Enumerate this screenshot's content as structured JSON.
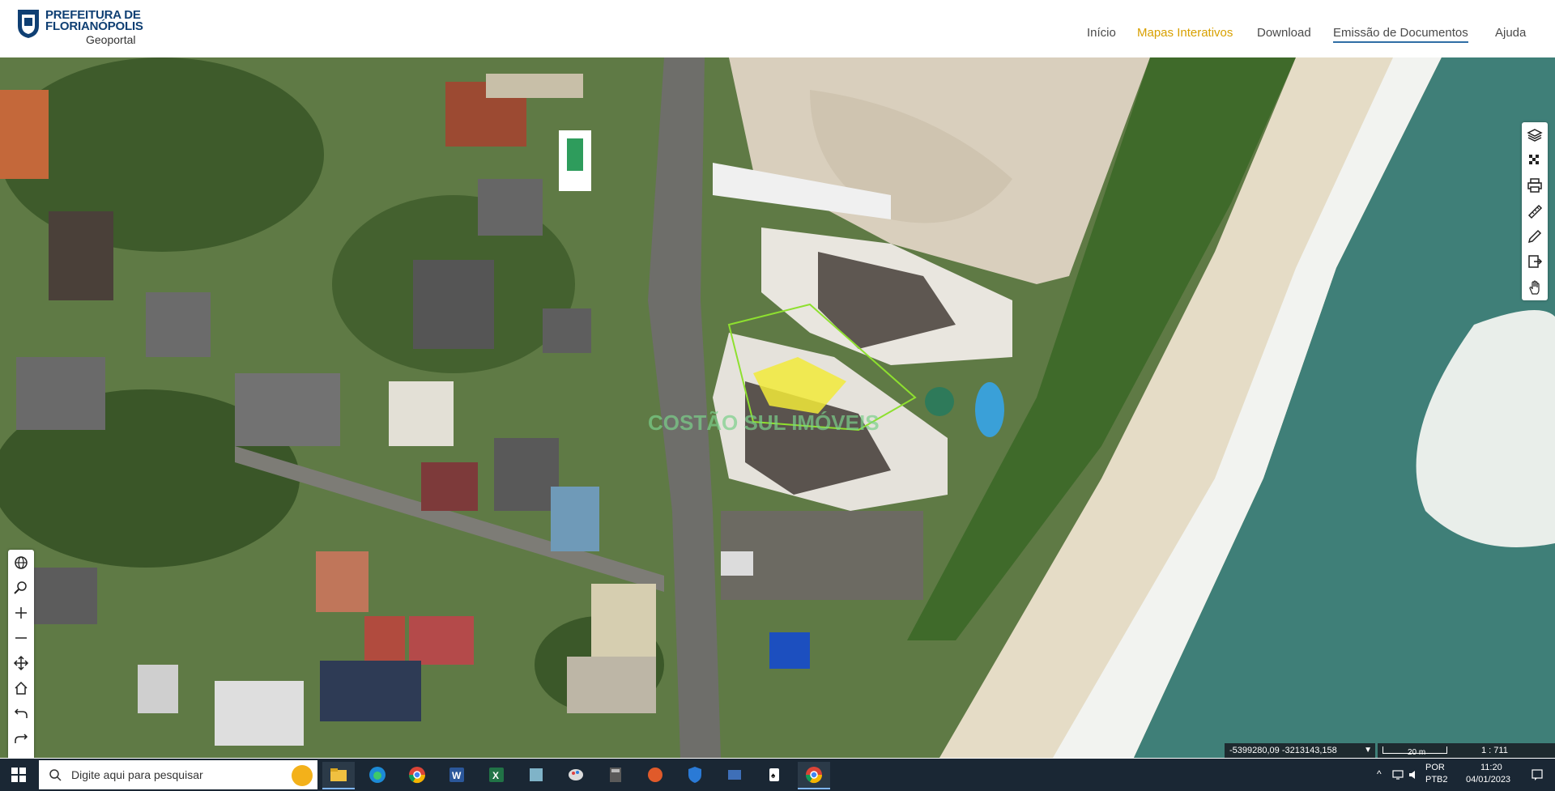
{
  "header": {
    "logo_line1": "PREFEITURA DE",
    "logo_line2": "FLORIANÓPOLIS",
    "logo_line3": "Geoportal",
    "nav": [
      {
        "label": "Início"
      },
      {
        "label": "Mapas Interativos"
      },
      {
        "label": "Download"
      },
      {
        "label": "Emissão de Documentos"
      },
      {
        "label": "Ajuda"
      }
    ]
  },
  "map": {
    "watermark": "COSTÃO SUL IMÓVEIS",
    "coords_text": "-5399280,09 -3213143,158",
    "scale_label": "20 m",
    "scale_ratio": "1 : 711"
  },
  "right_tools": [
    "layers-icon",
    "basemap-icon",
    "print-icon",
    "measure-icon",
    "draw-icon",
    "export-icon",
    "pan-hand-icon"
  ],
  "left_tools": [
    "globe-icon",
    "zoom-search-icon",
    "zoom-in-icon",
    "zoom-out-icon",
    "pan-move-icon",
    "home-icon",
    "undo-icon",
    "redo-icon",
    "fullscreen-icon",
    "location-icon"
  ],
  "taskbar": {
    "search_placeholder": "Digite aqui para pesquisar",
    "lang_line1": "POR",
    "lang_line2": "PTB2",
    "time": "11:20",
    "date": "04/01/2023",
    "apps": [
      "file-explorer-icon",
      "edge-icon",
      "chrome-icon",
      "word-icon",
      "excel-icon",
      "app-icon",
      "paint-icon",
      "calculator-icon",
      "app2-icon",
      "defender-icon",
      "app3-icon",
      "solitaire-icon",
      "chrome2-icon"
    ]
  },
  "colors": {
    "accent_nav": "#d8a000",
    "logo_blue": "#0f3f73",
    "taskbar_bg": "#1a2734"
  }
}
